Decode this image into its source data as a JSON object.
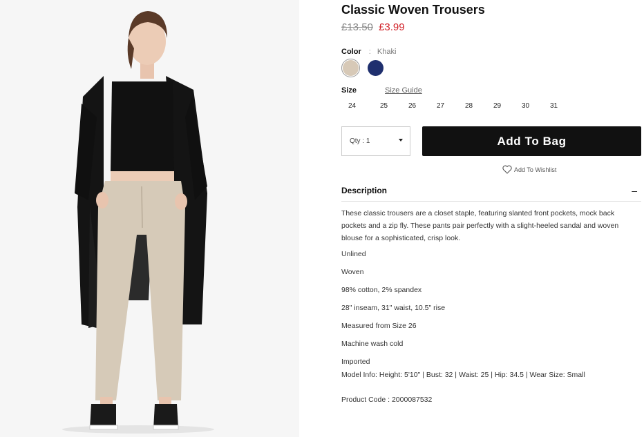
{
  "product": {
    "title": "Classic Woven Trousers",
    "old_price": "£13.50",
    "new_price": "£3.99"
  },
  "color": {
    "label": "Color",
    "separator": ":",
    "selected": "Khaki",
    "swatches": [
      {
        "name": "Khaki",
        "hex": "#d7c9b7",
        "selected": true
      },
      {
        "name": "Navy",
        "hex": "#1f2f6e",
        "selected": false
      }
    ]
  },
  "size": {
    "label": "Size",
    "guide_link": "Size Guide",
    "options": [
      "24",
      "25",
      "26",
      "27",
      "28",
      "29",
      "30",
      "31"
    ]
  },
  "quantity": {
    "value": "Qty : 1",
    "icon": "caret-down-icon"
  },
  "actions": {
    "add_to_bag": "Add To Bag",
    "wishlist": "Add To Wishlist",
    "wishlist_icon": "heart-icon"
  },
  "description": {
    "heading": "Description",
    "toggle": "–",
    "text": "These classic trousers are a closet staple, featuring slanted front pockets, mock back pockets and a zip fly. These pants pair perfectly with a slight-heeled sandal and woven blouse for a sophisticated, crisp look.",
    "features": [
      "Unlined",
      "Woven",
      "98% cotton, 2% spandex",
      "28\" inseam, 31\" waist, 10.5\" rise",
      "Measured from Size 26",
      "Machine wash cold",
      "Imported"
    ],
    "model_info": "Model Info: Height: 5'10\" | Bust: 32 | Waist: 25 | Hip: 34.5 | Wear Size: Small",
    "product_code": "Product Code : 2000087532"
  },
  "colors": {
    "accent_price": "#d2232a",
    "button_bg": "#111111"
  }
}
